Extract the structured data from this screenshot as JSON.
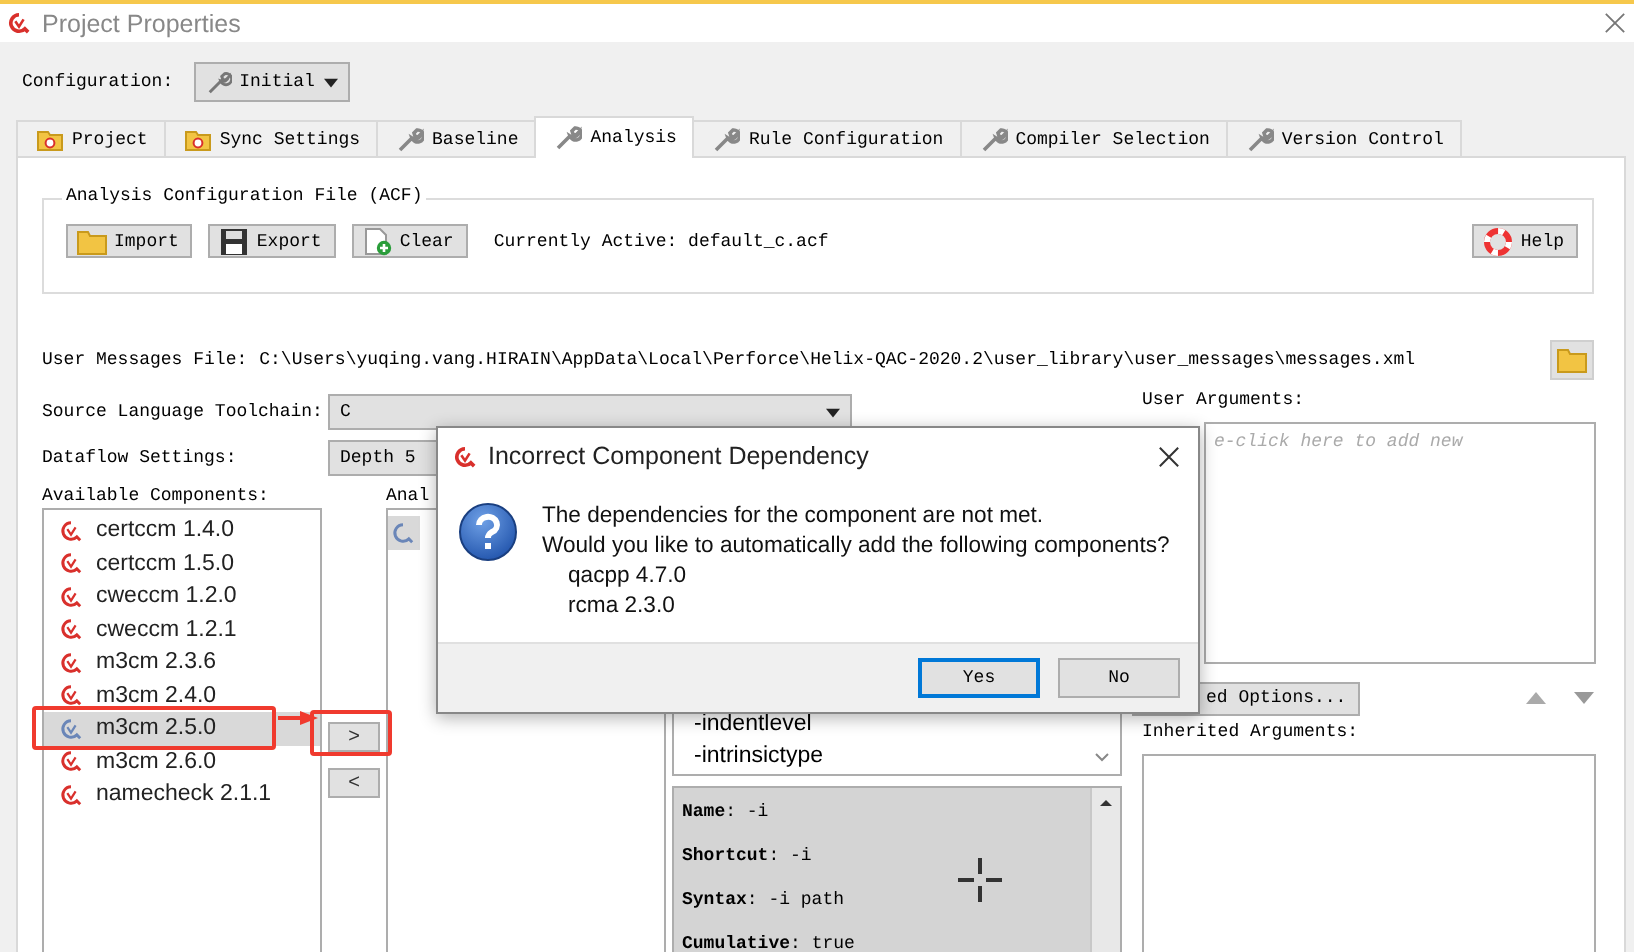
{
  "window": {
    "title": "Project Properties"
  },
  "configuration": {
    "label": "Configuration:",
    "value": "Initial"
  },
  "tabs": [
    {
      "label": "Project",
      "kind": "folder",
      "selected": false
    },
    {
      "label": "Sync Settings",
      "kind": "folder",
      "selected": false
    },
    {
      "label": "Baseline",
      "kind": "wrench",
      "selected": false
    },
    {
      "label": "Analysis",
      "kind": "wrench",
      "selected": true
    },
    {
      "label": "Rule Configuration",
      "kind": "wrench",
      "selected": false
    },
    {
      "label": "Compiler Selection",
      "kind": "wrench",
      "selected": false
    },
    {
      "label": "Version Control",
      "kind": "wrench",
      "selected": false
    }
  ],
  "acf": {
    "legend": "Analysis Configuration File (ACF)",
    "buttons": [
      {
        "label": "Import",
        "kind": "import"
      },
      {
        "label": "Export",
        "kind": "export"
      },
      {
        "label": "Clear",
        "kind": "clear"
      }
    ],
    "active": "Currently Active: default_c.acf",
    "help": "Help"
  },
  "user_messages": {
    "label": "User Messages File:",
    "path": "C:\\Users\\yuqing.vang.HIRAIN\\AppData\\Local\\Perforce\\Helix-QAC-2020.2\\user_library\\user_messages\\messages.xml"
  },
  "toolchain": {
    "label": "Source Language Toolchain:",
    "value": "C"
  },
  "dataflow": {
    "label": "Dataflow Settings:",
    "value": "Depth 5"
  },
  "available": {
    "label": "Available Components:",
    "items": [
      {
        "name": "certccm 1.4.0",
        "selected": false
      },
      {
        "name": "certccm 1.5.0",
        "selected": false
      },
      {
        "name": "cweccm 1.2.0",
        "selected": false
      },
      {
        "name": "cweccm 1.2.1",
        "selected": false
      },
      {
        "name": "m3cm 2.3.6",
        "selected": false
      },
      {
        "name": "m3cm 2.4.0",
        "selected": false
      },
      {
        "name": "m3cm 2.5.0",
        "selected": true
      },
      {
        "name": "m3cm 2.6.0",
        "selected": false
      },
      {
        "name": "namecheck 2.1.1",
        "selected": false
      }
    ]
  },
  "move_buttons": [
    ">",
    "<"
  ],
  "analysis": {
    "label": "Anal",
    "items": [
      {
        "selected": true
      }
    ]
  },
  "options": {
    "items": [
      "-indentlevel",
      "-intrinsictype"
    ]
  },
  "help_pane": {
    "lines": [
      "**Name**: -i",
      "**Shortcut**: -i",
      "**Syntax**: -i path",
      "**Cumulative**: true"
    ]
  },
  "user_arguments": {
    "label": "User Arguments:",
    "placeholder": "e-click here to add new"
  },
  "advanced_button": "ed Options...",
  "inherited": {
    "label": "Inherited Arguments:"
  },
  "dialog": {
    "title": "Incorrect Component Dependency",
    "message": [
      "The dependencies for the component are not met.",
      "Would you like to automatically add the following components?"
    ],
    "components": [
      "qacpp 4.7.0",
      "rcma 2.3.0"
    ],
    "buttons": [
      {
        "label": "Yes",
        "focused": true
      },
      {
        "label": "No",
        "focused": false
      }
    ]
  }
}
